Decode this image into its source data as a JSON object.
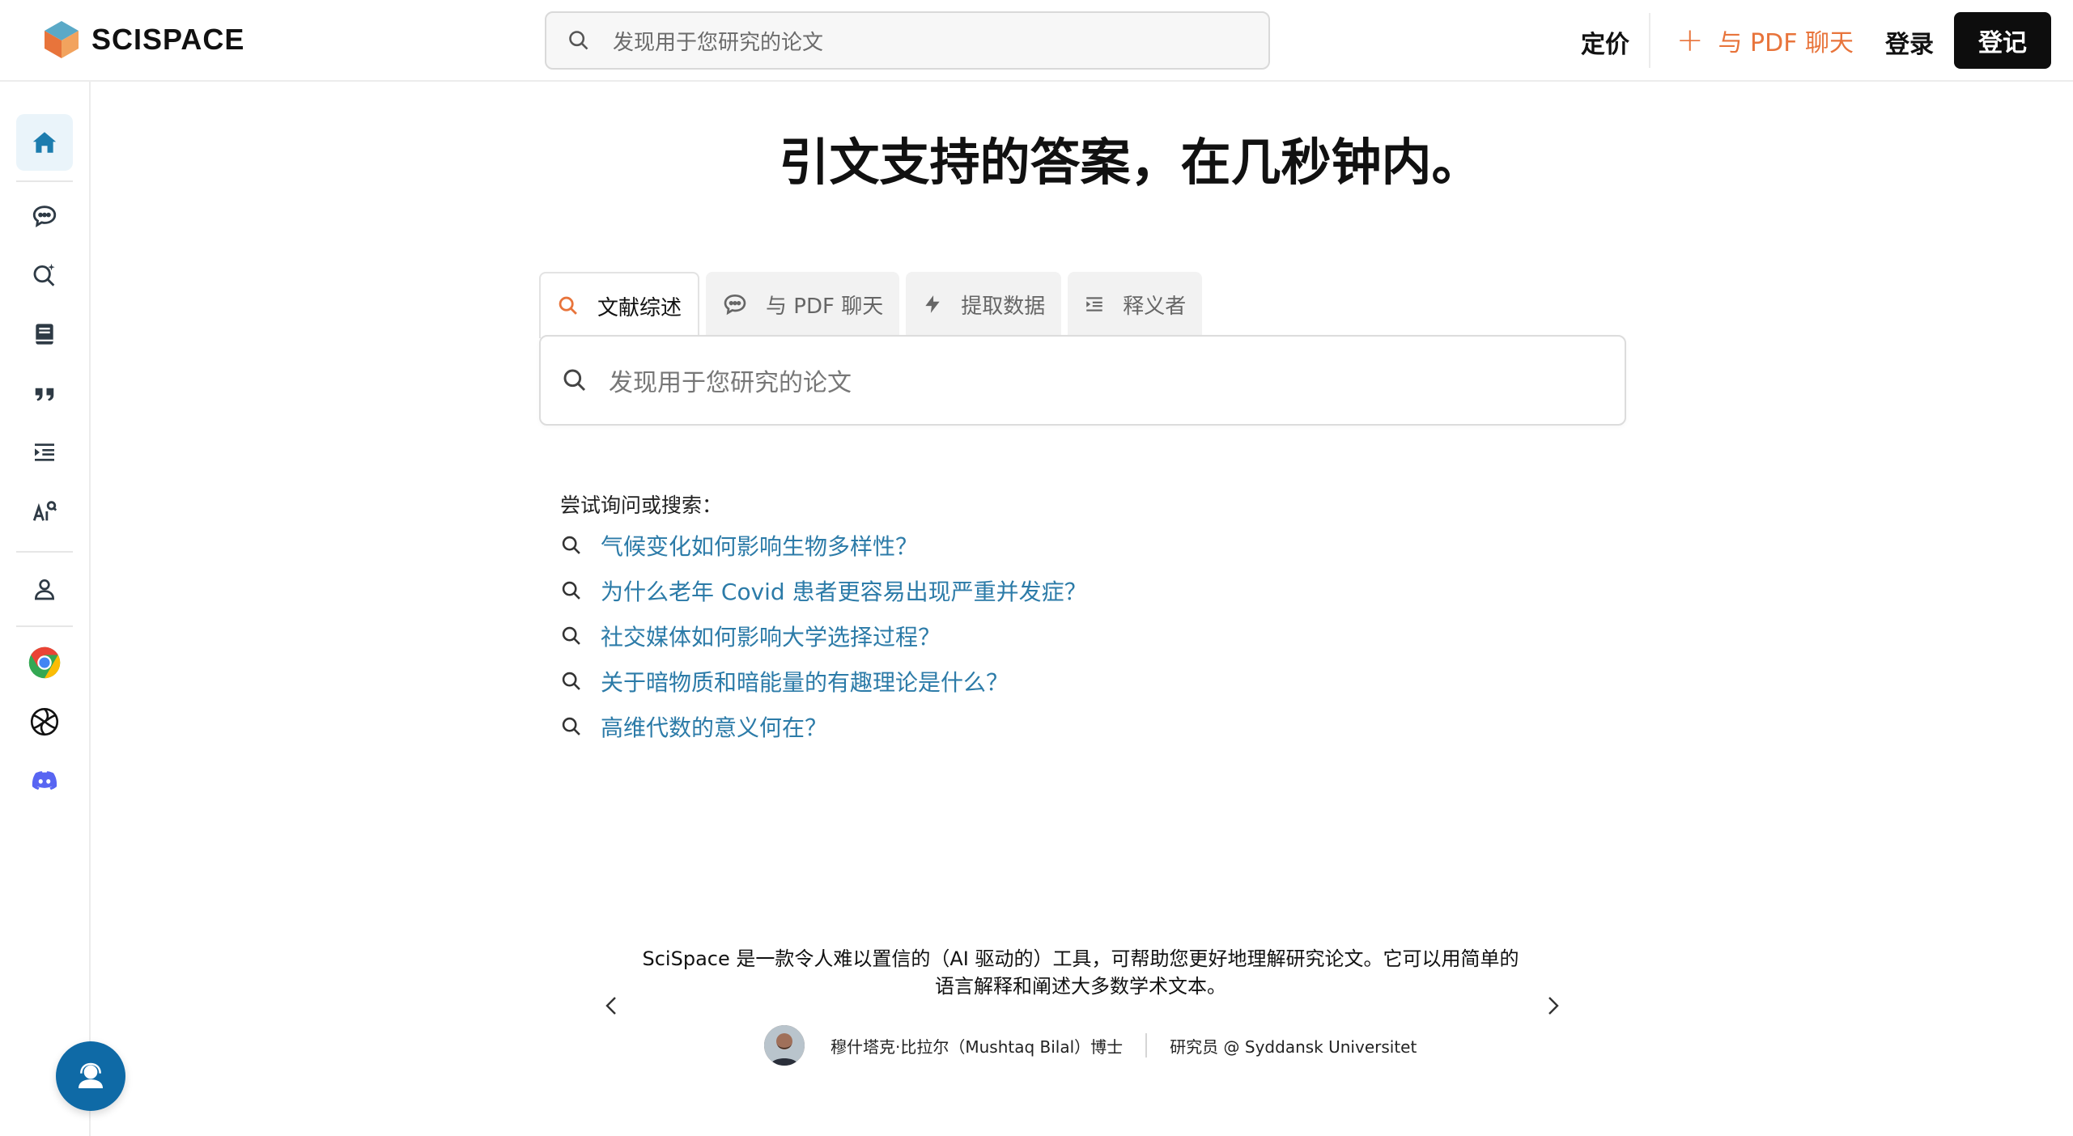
{
  "header": {
    "brand": "SCISPACE",
    "search_placeholder": "发现用于您研究的论文",
    "pricing": "定价",
    "chat_pdf": "与 PDF 聊天",
    "login": "登录",
    "signup": "登记"
  },
  "sidebar": {
    "items": [
      "home-icon",
      "chat-icon",
      "search-sparkle-icon",
      "notebook-icon",
      "quote-icon",
      "outline-icon",
      "ai-detect-icon",
      "user-icon",
      "chrome-icon",
      "openai-icon",
      "discord-icon"
    ],
    "active": "home-icon"
  },
  "main": {
    "headline": "引文支持的答案，在几秒钟内。",
    "tabs": [
      {
        "label": "文献综述",
        "icon": "search-icon",
        "active": true
      },
      {
        "label": "与 PDF 聊天",
        "icon": "chat-icon",
        "active": false
      },
      {
        "label": "提取数据",
        "icon": "bolt-icon",
        "active": false
      },
      {
        "label": "释义者",
        "icon": "paraphrase-icon",
        "active": false
      }
    ],
    "search_placeholder": "发现用于您研究的论文",
    "try_label": "尝试询问或搜索：",
    "suggestions": [
      "气候变化如何影响生物多样性？",
      "为什么老年 Covid 患者更容易出现严重并发症？",
      "社交媒体如何影响大学选择过程？",
      "关于暗物质和暗能量的有趣理论是什么？",
      "高维代数的意义何在？"
    ]
  },
  "testimonial": {
    "quote_line1": "SciSpace 是一款令人难以置信的（AI 驱动的）工具，可帮助您更好地理解研究论文。它可以用简单的",
    "quote_line2": "语言解释和阐述大多数学术文本。",
    "author": "穆什塔克·比拉尔（Mushtaq Bilal）博士",
    "role": "研究员 @ Syddansk Universitet"
  },
  "colors": {
    "accent_orange": "#e8743b",
    "link_blue": "#2c7ba8",
    "fab_blue": "#0f6aa6",
    "sidebar_icon": "#2e3a45",
    "active_bg": "#eaf4fa"
  }
}
